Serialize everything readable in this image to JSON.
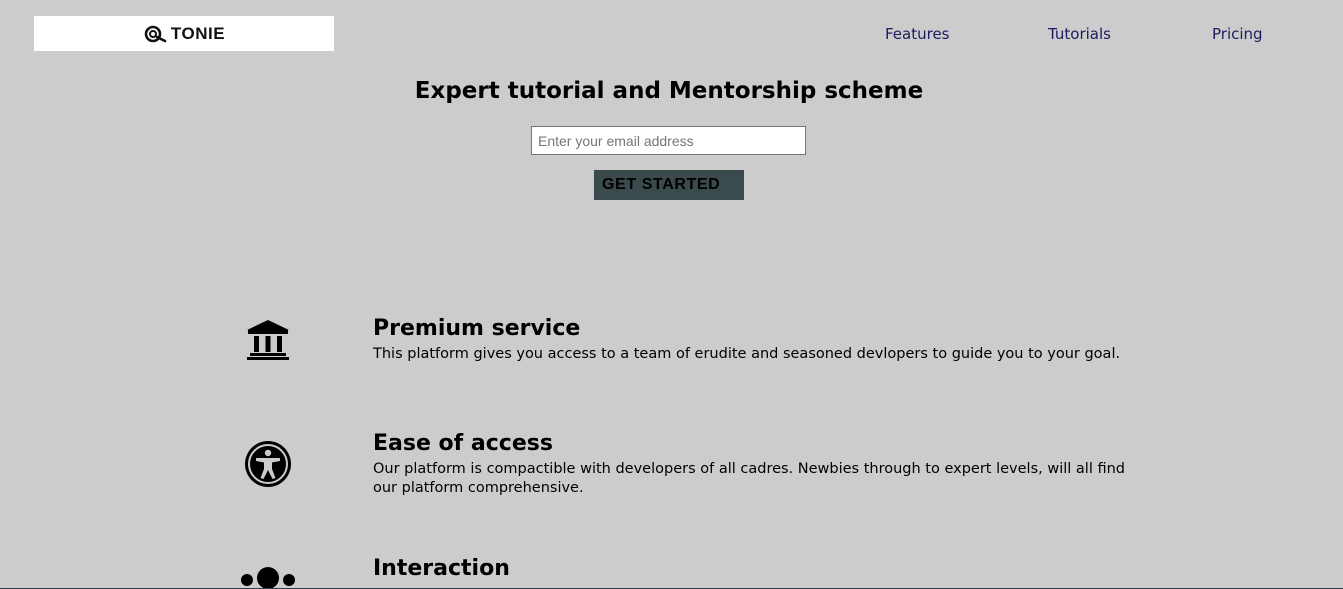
{
  "header": {
    "logo_text": "TONIE",
    "nav": {
      "features": "Features",
      "tutorials": "Tutorials",
      "pricing": "Pricing"
    }
  },
  "hero": {
    "title": "Expert tutorial and Mentorship scheme",
    "email_placeholder": "Enter your email address",
    "cta_label": "GET STARTED"
  },
  "features": [
    {
      "icon": "bank-icon",
      "title": "Premium service",
      "description": "This platform gives you access to a team of erudite and seasoned devlopers to guide you to your goal."
    },
    {
      "icon": "accessibility-icon",
      "title": "Ease of access",
      "description": "Our platform is compactible with developers of all cadres. Newbies through to expert levels, will all find our platform comprehensive."
    },
    {
      "icon": "dots-icon",
      "title": "Interaction",
      "description": ""
    }
  ],
  "colors": {
    "background": "#cccccc",
    "nav_link": "#1b1b5e",
    "cta_background": "#3b4a4c"
  }
}
